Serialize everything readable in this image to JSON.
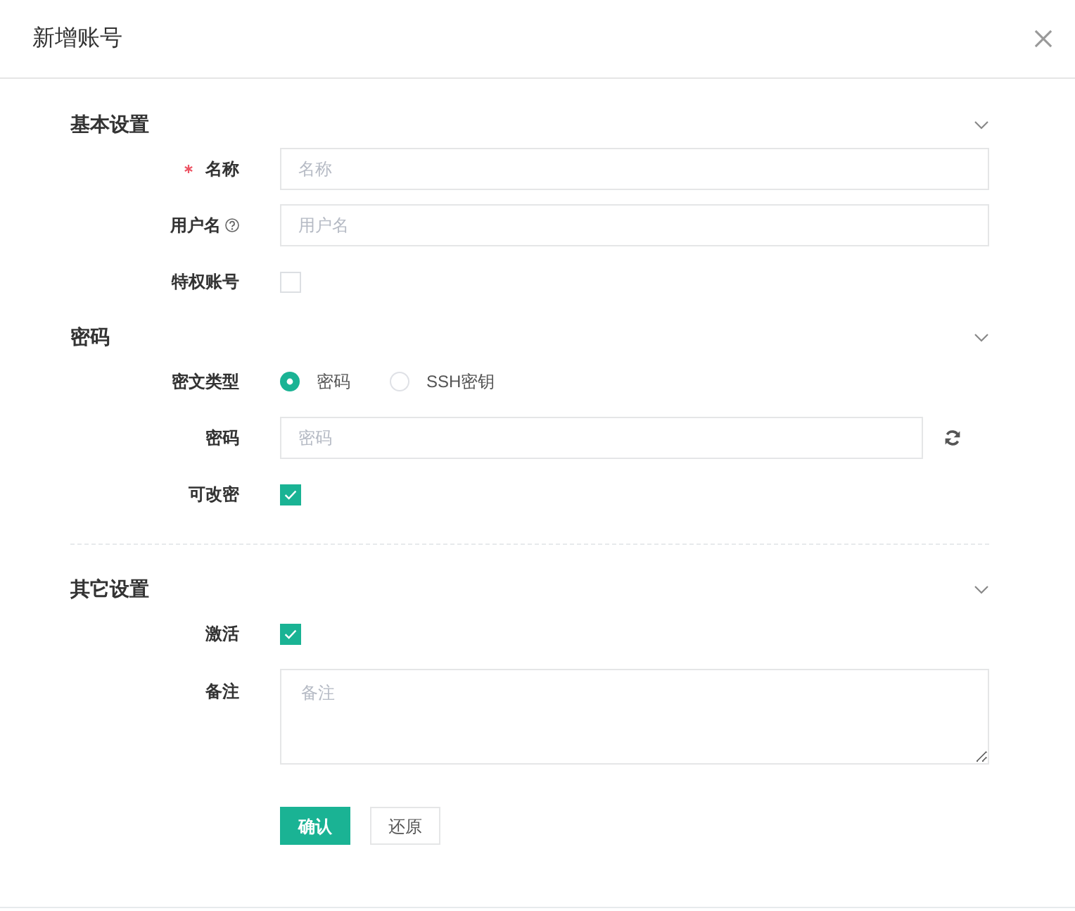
{
  "dialog": {
    "title": "新增账号"
  },
  "sections": [
    {
      "title": "基本设置",
      "expanded": true,
      "divider_after": false,
      "fields": [
        {
          "kind": "text",
          "label": "名称",
          "required": true,
          "help": false,
          "placeholder": "名称"
        },
        {
          "kind": "text",
          "label": "用户名",
          "required": false,
          "help": true,
          "placeholder": "用户名"
        },
        {
          "kind": "checkbox",
          "label": "特权账号",
          "required": false,
          "help": false,
          "checked": false
        }
      ]
    },
    {
      "title": "密码",
      "expanded": true,
      "divider_after": true,
      "fields": [
        {
          "kind": "radio",
          "label": "密文类型",
          "required": false,
          "help": false,
          "options": [
            {
              "label": "密码",
              "selected": true
            },
            {
              "label": "SSH密钥",
              "selected": false
            }
          ]
        },
        {
          "kind": "password",
          "label": "密码",
          "required": false,
          "help": false,
          "placeholder": "密码"
        },
        {
          "kind": "checkbox",
          "label": "可改密",
          "required": false,
          "help": false,
          "checked": true
        }
      ]
    },
    {
      "title": "其它设置",
      "expanded": true,
      "divider_after": false,
      "fields": [
        {
          "kind": "checkbox",
          "label": "激活",
          "required": false,
          "help": false,
          "checked": true
        },
        {
          "kind": "textarea",
          "label": "备注",
          "required": false,
          "help": false,
          "placeholder": "备注"
        }
      ]
    }
  ],
  "buttons": [
    {
      "label": "确认",
      "kind": "primary"
    },
    {
      "label": "还原",
      "kind": "default"
    }
  ]
}
